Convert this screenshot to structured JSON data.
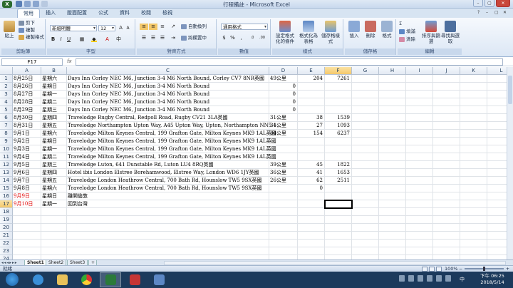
{
  "window": {
    "title": "行程備註 - Microsoft Excel"
  },
  "ribbon_tabs": [
    "常用",
    "插入",
    "版面配置",
    "公式",
    "資料",
    "校閱",
    "檢視"
  ],
  "active_tab": "常用",
  "ribbon": {
    "clipboard": {
      "label": "剪貼簿",
      "paste": "貼上",
      "cut": "剪下",
      "copy": "複製",
      "format_painter": "複製格式"
    },
    "font": {
      "label": "字型",
      "font_name": "新細明體",
      "font_size": "12"
    },
    "alignment": {
      "label": "對齊方式",
      "wrap": "自動換列",
      "merge": "跨欄置中"
    },
    "number": {
      "label": "數值",
      "format": "通用格式"
    },
    "styles": {
      "label": "樣式",
      "conditional": "設定格式化的條件",
      "as_table": "格式化為表格",
      "cell_styles": "儲存格樣式"
    },
    "cells": {
      "label": "儲存格",
      "insert": "插入",
      "delete": "刪除",
      "format": "格式"
    },
    "editing": {
      "label": "編輯",
      "fill": "填滿",
      "clear": "清除",
      "sort_filter": "排序與篩選",
      "find_select": "尋找與選取"
    }
  },
  "formula_bar": {
    "name_box": "F17",
    "fx": "fx",
    "value": ""
  },
  "columns": [
    "A",
    "B",
    "C",
    "D",
    "E",
    "F",
    "G",
    "H",
    "I",
    "J",
    "K",
    "L"
  ],
  "selected_column": "F",
  "selected_row": "17",
  "rows": [
    {
      "n": "1",
      "A": "8月25日",
      "B": "星期六",
      "C": "Days Inn Corley NEC M6, Junction 3-4 M6 North Bound, Corley CV7 8NR英國",
      "D": "49公里",
      "E": "204",
      "F": "7261",
      "redA": false
    },
    {
      "n": "2",
      "A": "8月26日",
      "B": "星期日",
      "C": "Days Inn Corley NEC M6, Junction 3-4 M6 North Bound",
      "D": "0",
      "E": "",
      "F": "",
      "redA": false
    },
    {
      "n": "3",
      "A": "8月27日",
      "B": "星期一",
      "C": "Days Inn Corley NEC M6, Junction 3-4 M6 North Bound",
      "D": "0",
      "E": "",
      "F": "",
      "redA": false
    },
    {
      "n": "4",
      "A": "8月28日",
      "B": "星期二",
      "C": "Days Inn Corley NEC M6, Junction 3-4 M6 North Bound",
      "D": "0",
      "E": "",
      "F": "",
      "redA": false
    },
    {
      "n": "5",
      "A": "8月29日",
      "B": "星期三",
      "C": "Days Inn Corley NEC M6, Junction 3-4 M6 North Bound",
      "D": "0",
      "E": "",
      "F": "",
      "redA": false
    },
    {
      "n": "6",
      "A": "8月30日",
      "B": "星期四",
      "C": "Travelodge Rugby Central, Redpoll Road, Rugby CV21 3LA英國",
      "D": "31公里",
      "E": "38",
      "F": "1539",
      "redA": false
    },
    {
      "n": "7",
      "A": "8月31日",
      "B": "星期五",
      "C": "Travelodge Northampton Upton Way, A45 Upton Way, Upton, Northampton NN5 4",
      "D": "31公里",
      "E": "27",
      "F": "1093",
      "redA": false
    },
    {
      "n": "8",
      "A": "9月1日",
      "B": "星期六",
      "C": "Travelodge Milton Keynes Central, 199 Grafton Gate, Milton Keynes MK9 1AL英國",
      "D": "34公里",
      "E": "154",
      "F": "6237",
      "redA": false
    },
    {
      "n": "9",
      "A": "9月2日",
      "B": "星期日",
      "C": "Travelodge Milton Keynes Central, 199 Grafton Gate, Milton Keynes MK9 1AL英國",
      "D": "",
      "E": "",
      "F": "",
      "redA": false
    },
    {
      "n": "10",
      "A": "9月3日",
      "B": "星期一",
      "C": "Travelodge Milton Keynes Central, 199 Grafton Gate, Milton Keynes MK9 1AL英國",
      "D": "",
      "E": "",
      "F": "",
      "redA": false
    },
    {
      "n": "11",
      "A": "9月4日",
      "B": "星期二",
      "C": "Travelodge Milton Keynes Central, 199 Grafton Gate, Milton Keynes MK9 1AL英國",
      "D": "",
      "E": "",
      "F": "",
      "redA": false
    },
    {
      "n": "12",
      "A": "9月5日",
      "B": "星期三",
      "C": "Travelodge Luton, 641 Dunstable Rd, Luton LU4 8RQ英國",
      "D": "39公里",
      "E": "45",
      "F": "1822",
      "redA": false
    },
    {
      "n": "13",
      "A": "9月6日",
      "B": "星期四",
      "C": "Hotel ibis London Elstree Borehamwood, Elstree Way, London WD6 1JY英國",
      "D": "36公里",
      "E": "41",
      "F": "1653",
      "redA": false
    },
    {
      "n": "14",
      "A": "9月7日",
      "B": "星期五",
      "C": "Travelodge London Heathrow Central, 700 Bath Rd, Hounslow TW5 9SX英國",
      "D": "26公里",
      "E": "62",
      "F": "2511",
      "redA": false
    },
    {
      "n": "15",
      "A": "9月8日",
      "B": "星期六",
      "C": "Travelodge London Heathrow Central, 700 Bath Rd, Hounslow TW5 9SX英國",
      "D": "",
      "E": "0",
      "F": "",
      "redA": false
    },
    {
      "n": "16",
      "A": "9月9日",
      "B": "星期日",
      "C": "離開倫敦",
      "D": "",
      "E": "",
      "F": "",
      "redA": true
    },
    {
      "n": "17",
      "A": "9月10日",
      "B": "星期一",
      "C": "回到台灣",
      "D": "",
      "E": "",
      "F": "",
      "redA": true
    },
    {
      "n": "18",
      "A": "",
      "B": "",
      "C": "",
      "D": "",
      "E": "",
      "F": "",
      "redA": false
    },
    {
      "n": "19",
      "A": "",
      "B": "",
      "C": "",
      "D": "",
      "E": "",
      "F": "",
      "redA": false
    },
    {
      "n": "20",
      "A": "",
      "B": "",
      "C": "",
      "D": "",
      "E": "",
      "F": "",
      "redA": false
    },
    {
      "n": "21",
      "A": "",
      "B": "",
      "C": "",
      "D": "",
      "E": "",
      "F": "",
      "redA": false
    },
    {
      "n": "22",
      "A": "",
      "B": "",
      "C": "",
      "D": "",
      "E": "",
      "F": "",
      "redA": false
    },
    {
      "n": "23",
      "A": "",
      "B": "",
      "C": "",
      "D": "",
      "E": "",
      "F": "",
      "redA": false
    },
    {
      "n": "24",
      "A": "",
      "B": "",
      "C": "",
      "D": "",
      "E": "",
      "F": "",
      "redA": false
    }
  ],
  "sheets": [
    "Sheet1",
    "Sheet2",
    "Sheet3"
  ],
  "active_sheet": "Sheet1",
  "status": {
    "ready": "就緒",
    "zoom": "100%"
  },
  "taskbar": {
    "lang": "中",
    "time": "下午 06:25",
    "date": "2018/5/14"
  },
  "colors": {
    "red_text": "#e00000",
    "ribbon_bg": "#dce7f5",
    "taskbar": "#1c3a5c",
    "selection": "#f4c86a"
  }
}
